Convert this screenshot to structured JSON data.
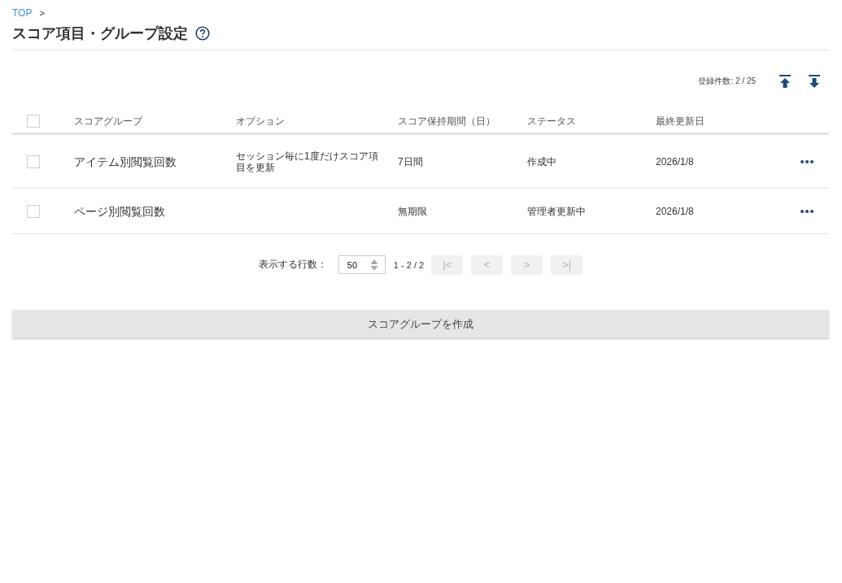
{
  "breadcrumb": {
    "items": [
      {
        "label": "TOP"
      }
    ],
    "separator": ">"
  },
  "page_title": "スコア項目・グループ設定",
  "record_count": "登録件数: 2 / 25",
  "table": {
    "select_all_checked": false,
    "columns": [
      "スコアグループ",
      "オプション",
      "スコア保持期間（日）",
      "ステータス",
      "最終更新日"
    ],
    "rows": [
      {
        "checked": false,
        "score_group": "アイテム別閲覧回数",
        "option": "セッション毎に1度だけスコア項目を更新",
        "retention": "7日間",
        "status": "作成中",
        "updated": "2026/1/8"
      },
      {
        "checked": false,
        "score_group": "ページ別閲覧回数",
        "retention": "無期限",
        "status": "管理者更新中",
        "updated": "2026/1/8"
      }
    ]
  },
  "pagination": {
    "rows_label": "表示する行数：",
    "rows_per_page": "50",
    "range": "1 - 2 / 2",
    "buttons": [
      {
        "label": "|<",
        "disabled": true
      },
      {
        "label": "<",
        "disabled": true
      },
      {
        "label": ">",
        "disabled": true
      },
      {
        "label": ">|",
        "disabled": true
      }
    ]
  },
  "create_button": "スコアグループを作成"
}
